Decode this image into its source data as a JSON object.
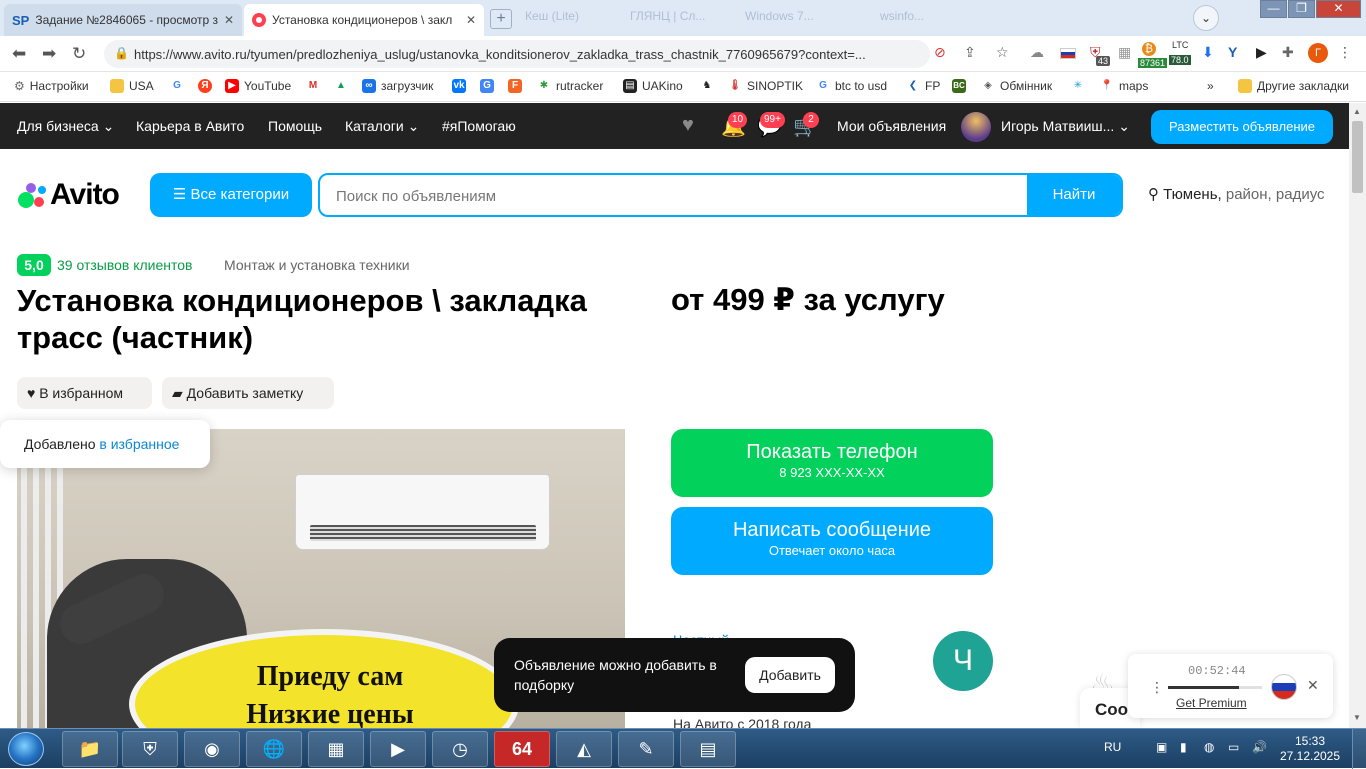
{
  "browser": {
    "tabs": [
      {
        "label": "Задание №2846065 - просмотр з",
        "active": false
      },
      {
        "label": "Установка кондиционеров \\ закл",
        "active": true
      }
    ],
    "ghost_tabs": [
      "Кеш (Lite)",
      "ГЛЯНЦ | Сл...",
      "Windows 7...",
      "wsinfo..."
    ],
    "profile_letter": "Г",
    "url": "https://www.avito.ru/tyumen/predlozheniya_uslug/ustanovka_konditsionerov_zakladka_trass_chastnik_7760965679?context=...",
    "ext_labels": {
      "badge_43": "43",
      "ltc": "LTC",
      "ltc_val": "78.0",
      "btc_val": "87361"
    },
    "bookmarks": [
      {
        "label": "Настройки",
        "icon": "gear-icon"
      },
      {
        "label": "USA",
        "icon": "folder-icon"
      },
      {
        "label": "",
        "icon": "google-icon"
      },
      {
        "label": "",
        "icon": "yandex-icon"
      },
      {
        "label": "YouTube",
        "icon": "youtube-icon"
      },
      {
        "label": "",
        "icon": "gmail-icon"
      },
      {
        "label": "",
        "icon": "drive-icon"
      },
      {
        "label": "загрузчик",
        "icon": "loop-icon"
      },
      {
        "label": "",
        "icon": "vk-icon"
      },
      {
        "label": "",
        "icon": "translate-icon"
      },
      {
        "label": "",
        "icon": "f-icon"
      },
      {
        "label": "rutracker",
        "icon": "rutracker-icon"
      },
      {
        "label": "UAKino",
        "icon": "uakino-icon"
      },
      {
        "label": "",
        "icon": "chess-icon"
      },
      {
        "label": "SINOPTIK",
        "icon": "thermometer-icon"
      },
      {
        "label": "btc to usd",
        "icon": "google-icon"
      },
      {
        "label": "FP",
        "icon": "fp-icon"
      },
      {
        "label": "",
        "icon": "bc-icon"
      },
      {
        "label": "Обмінник",
        "icon": "exchange-icon"
      },
      {
        "label": "",
        "icon": "star-icon"
      },
      {
        "label": "maps",
        "icon": "maps-icon"
      }
    ],
    "bookmarks_more": "»",
    "other_bookmarks": "Другие закладки"
  },
  "avito": {
    "topnav": {
      "business": "Для бизнеса",
      "career": "Карьера в Авито",
      "help": "Помощь",
      "catalogs": "Каталоги",
      "help_tag": "#яПомогаю",
      "notif_badge": "10",
      "msg_badge": "99+",
      "cart_badge": "2",
      "my_ads": "Мои объявления",
      "user_name": "Игорь Матвииш...",
      "post_button": "Разместить объявление"
    },
    "logo": "Avito",
    "categories_button": "Все категории",
    "search_placeholder": "Поиск по объявлениям",
    "find_button": "Найти",
    "location_city": "Тюмень,",
    "location_rest": " район, радиус",
    "rating": "5,0",
    "reviews": "39 отзывов клиентов",
    "category": "Монтаж и установка техники",
    "title": "Установка кондиционеров \\ закладка трасс (частник)",
    "price": "от 499 ₽ за услугу",
    "fav_button": "В избранном",
    "note_button": "Добавить заметку",
    "fav_toast_prefix": "Добавлено ",
    "fav_toast_link": "в избранное",
    "photo_text_1": "Приеду сам",
    "photo_text_2": "Низкие цены",
    "phone_button": {
      "title": "Показать телефон",
      "sub": "8 923 XXX-XX-XX",
      "color": "#02d15c"
    },
    "message_button": {
      "title": "Написать сообщение",
      "sub": "Отвечает около часа",
      "color": "#00aaff"
    },
    "seller_link": "Частный",
    "seller_initial": "Ч",
    "since": "На Авито с 2018 года",
    "snackbar_text": "Объявление можно добавить в подборку",
    "snackbar_button": "Добавить",
    "coo_text": "Coo"
  },
  "recorder": {
    "time": "00:52:44",
    "progress": 0.75,
    "premium": "Get Premium"
  },
  "taskbar": {
    "lang": "RU",
    "time": "15:33",
    "date": "27.12.2025",
    "app_64_label": "64"
  }
}
